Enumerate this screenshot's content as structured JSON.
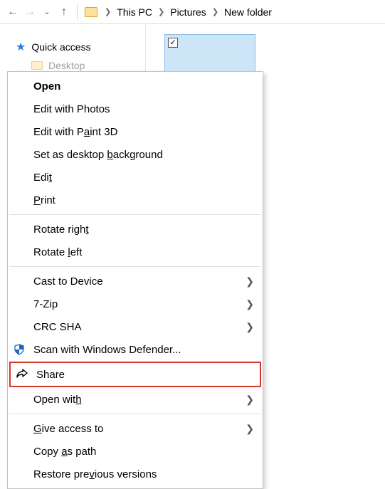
{
  "addressbar": {
    "crumbs": [
      "This PC",
      "Pictures",
      "New folder"
    ]
  },
  "sidebar": {
    "quick_access": "Quick access",
    "desktop": "Desktop"
  },
  "context_menu": {
    "open": {
      "label": "Open"
    },
    "edit_photos": {
      "label": "Edit with Photos"
    },
    "edit_paint3d": {
      "pre": "Edit with P",
      "accel": "a",
      "post": "int 3D"
    },
    "set_bg": {
      "pre": "Set as desktop ",
      "accel": "b",
      "post": "ackground"
    },
    "edit": {
      "pre": "Edi",
      "accel": "t",
      "post": ""
    },
    "print": {
      "pre": "",
      "accel": "P",
      "post": "rint"
    },
    "rotate_right": {
      "pre": "Rotate righ",
      "accel": "t",
      "post": ""
    },
    "rotate_left": {
      "pre": "Rotate ",
      "accel": "l",
      "post": "eft"
    },
    "cast": {
      "label": "Cast to Device"
    },
    "sevenzip": {
      "label": "7-Zip"
    },
    "crc": {
      "label": "CRC SHA"
    },
    "defender": {
      "label": "Scan with Windows Defender..."
    },
    "share": {
      "label": "Share"
    },
    "open_with": {
      "pre": "Open wit",
      "accel": "h",
      "post": ""
    },
    "give_access": {
      "pre": "",
      "accel": "G",
      "post": "ive access to"
    },
    "copy_path": {
      "pre": "Copy ",
      "accel": "a",
      "post": "s path"
    },
    "restore_prev": {
      "pre": "Restore pre",
      "accel": "v",
      "post": "ious versions"
    }
  }
}
